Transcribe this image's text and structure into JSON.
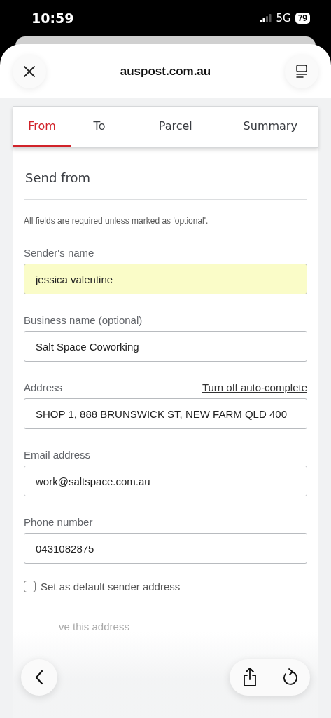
{
  "status_bar": {
    "time": "10:59",
    "network": "5G",
    "battery": "79"
  },
  "browser": {
    "url": "auspost.com.au"
  },
  "tabs": [
    {
      "label": "From",
      "selected": true
    },
    {
      "label": "To",
      "selected": false
    },
    {
      "label": "Parcel",
      "selected": false
    },
    {
      "label": "Summary",
      "selected": false
    }
  ],
  "section_title": "Send from",
  "note": "All fields are required unless marked as 'optional'.",
  "fields": [
    {
      "label": "Sender's name",
      "value": "jessica valentine",
      "autofilled": true
    },
    {
      "label": "Business name (optional)",
      "value": "Salt Space Coworking",
      "autofilled": false
    },
    {
      "label": "Address",
      "value": "SHOP 1, 888 BRUNSWICK ST, NEW FARM QLD 400",
      "autofilled": false,
      "link": "Turn off auto-complete"
    },
    {
      "label": "Email address",
      "value": "work@saltspace.com.au",
      "autofilled": false
    },
    {
      "label": "Phone number",
      "value": "0431082875",
      "autofilled": false
    }
  ],
  "default_checkbox": {
    "label": "Set as default sender address",
    "checked": false
  },
  "save_option": {
    "label": "ve this address"
  }
}
